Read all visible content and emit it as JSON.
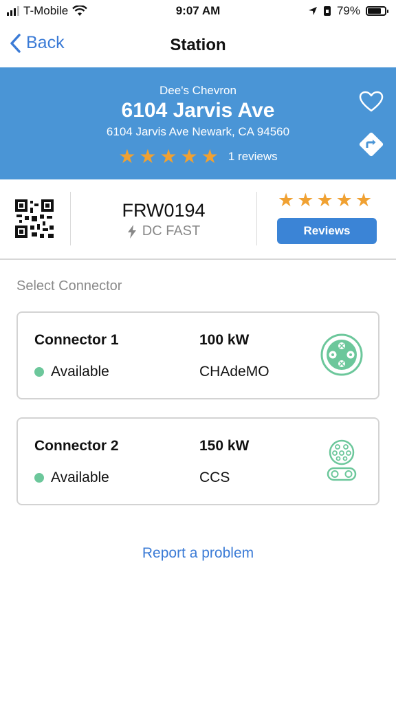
{
  "status_bar": {
    "carrier": "T-Mobile",
    "time": "9:07 AM",
    "battery": "79%",
    "battery_level": 0.79,
    "icons": [
      "signal-icon",
      "wifi-icon",
      "location-arrow-icon",
      "portrait-lock-icon",
      "battery-icon"
    ]
  },
  "nav": {
    "back_label": "Back",
    "title": "Station"
  },
  "station": {
    "brand": "Dee's Chevron",
    "name": "6104 Jarvis Ave",
    "address": "6104 Jarvis Ave Newark, CA 94560",
    "rating": 5,
    "reviews_count_label": "1 reviews",
    "id": "FRW0194",
    "speed_label": "DC FAST",
    "reviews_button": "Reviews"
  },
  "colors": {
    "banner": "#4a95d6",
    "accent": "#3b7bd6",
    "star": "#f0a132",
    "available": "#6cc79b"
  },
  "connectors": {
    "section_label": "Select Connector",
    "items": [
      {
        "name": "Connector 1",
        "status": "Available",
        "power": "100 kW",
        "type": "CHAdeMO",
        "icon": "chademo-connector-icon"
      },
      {
        "name": "Connector 2",
        "status": "Available",
        "power": "150 kW",
        "type": "CCS",
        "icon": "ccs-connector-icon"
      }
    ]
  },
  "footer": {
    "report_label": "Report a problem"
  }
}
